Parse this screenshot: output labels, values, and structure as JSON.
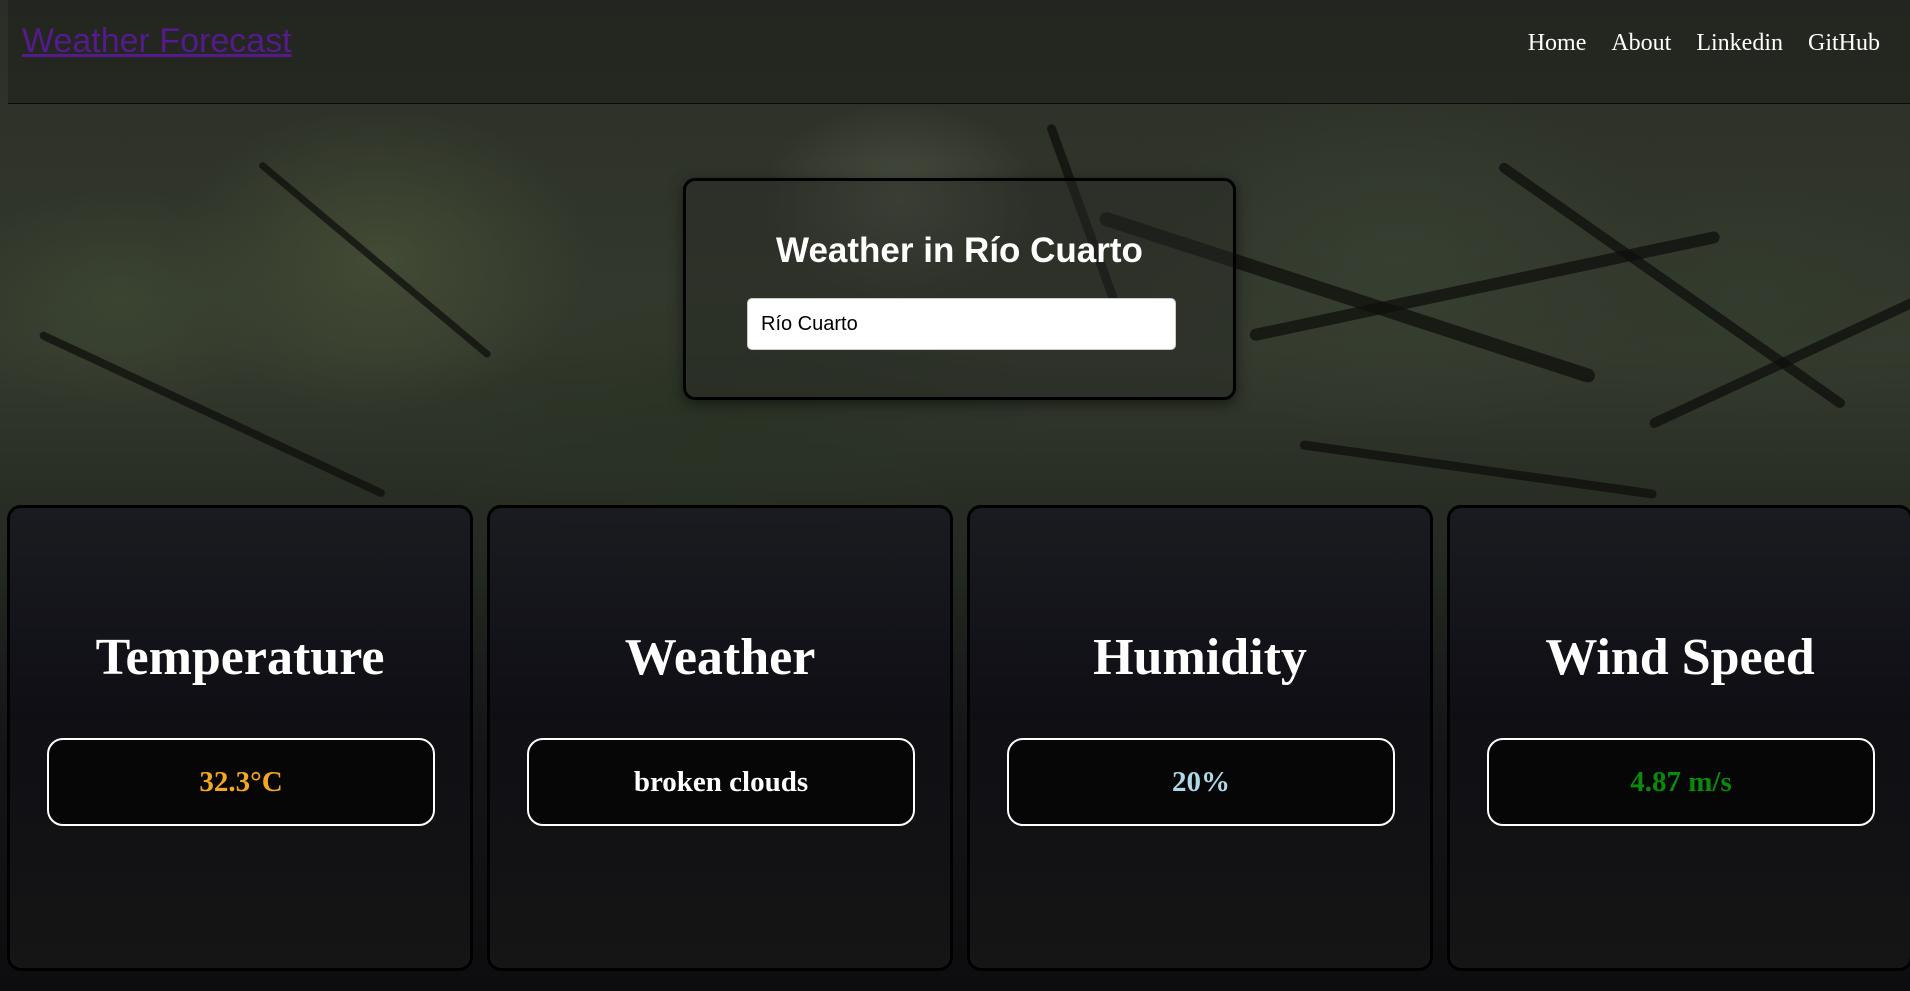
{
  "navbar": {
    "brand": "Weather Forecast",
    "links": [
      "Home",
      "About",
      "Linkedin",
      "GitHub"
    ]
  },
  "search": {
    "title": "Weather in Río Cuarto",
    "value": "Río Cuarto"
  },
  "cards": [
    {
      "title": "Temperature",
      "value": "32.3°C",
      "color": "#f5a623"
    },
    {
      "title": "Weather",
      "value": "broken clouds",
      "color": "#ffffff"
    },
    {
      "title": "Humidity",
      "value": "20%",
      "color": "#add8e6"
    },
    {
      "title": "Wind Speed",
      "value": "4.87 m/s",
      "color": "#0a8a0a"
    }
  ]
}
